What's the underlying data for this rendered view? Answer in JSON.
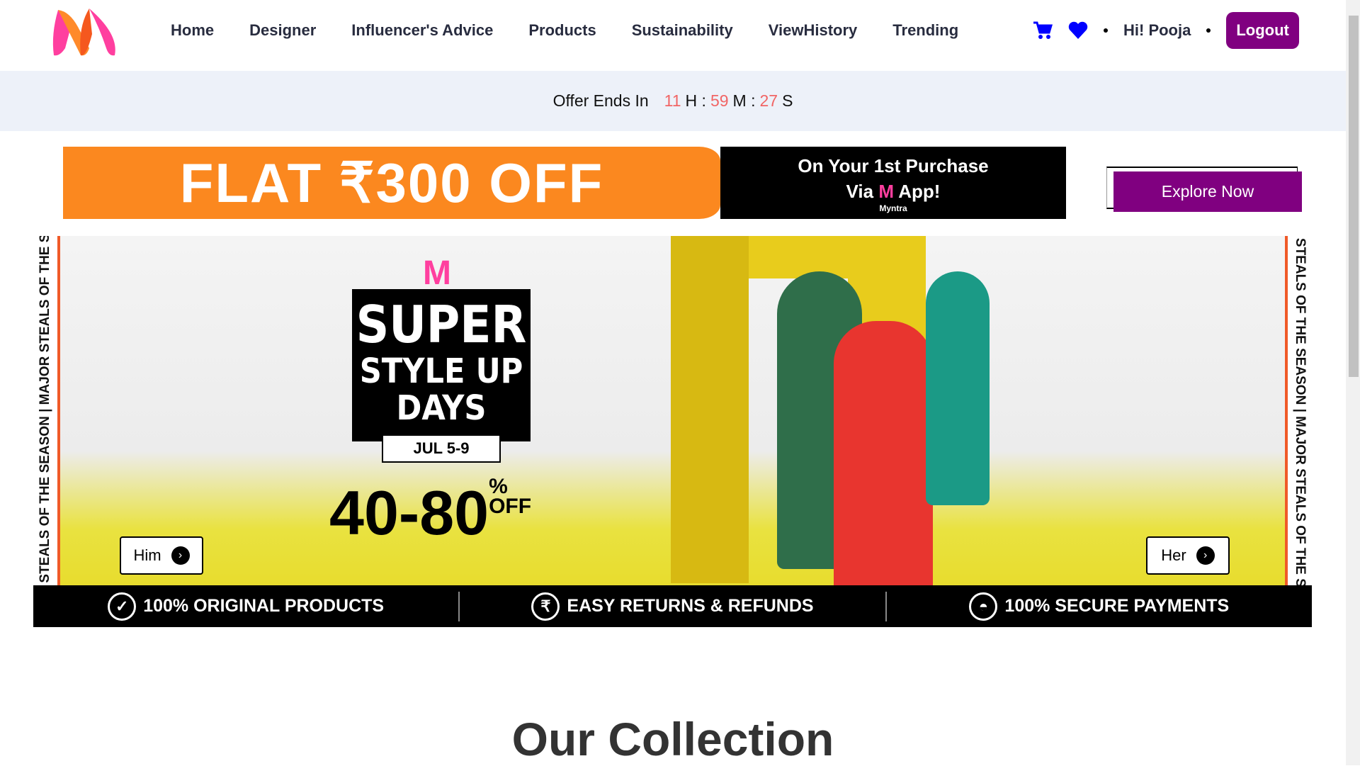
{
  "nav": {
    "links": [
      "Home",
      "Designer",
      "Influencer's Advice",
      "Products",
      "Sustainability",
      "ViewHistory",
      "Trending"
    ],
    "greeting": "Hi! Pooja",
    "logout": "Logout",
    "cart_icon": "cart-icon",
    "wishlist_icon": "heart-icon"
  },
  "offer": {
    "label": "Offer Ends In",
    "hours": "11",
    "h": "H :",
    "minutes": "59",
    "m": "M :",
    "seconds": "27",
    "s": "S"
  },
  "promo": {
    "main": "FLAT ₹300 OFF",
    "line1": "On Your 1st Purchase",
    "line2_a": "Via",
    "line2_b": "App!",
    "brand": "Myntra",
    "explore": "Explore Now"
  },
  "hero": {
    "side_text": "MAJOR STEALS OF THE SEASON | MAJOR STEALS OF THE SEASON",
    "title1": "SUPER",
    "title2": "STYLE UP",
    "title3": "DAYS",
    "date": "JUL 5-9",
    "discount": "40-80",
    "pct": "%",
    "off": "OFF",
    "him": "Him",
    "her": "Her"
  },
  "trust": [
    "100% ORIGINAL PRODUCTS",
    "EASY RETURNS & REFUNDS",
    "100% SECURE PAYMENTS"
  ],
  "collection_title": "Our Collection",
  "colors": {
    "brand": "#800080",
    "orange": "#fb881f",
    "countdown": "#f16565",
    "offer_bg": "#edf1f9"
  }
}
